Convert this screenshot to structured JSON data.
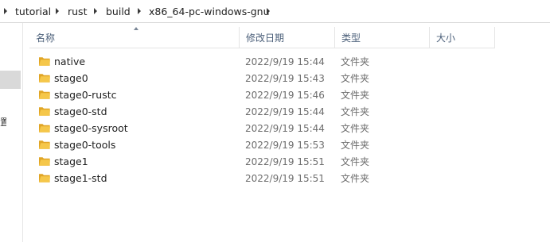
{
  "breadcrumb": {
    "items": [
      "tutorial",
      "rust",
      "build",
      "x86_64-pc-windows-gnu"
    ]
  },
  "nav": {
    "peek_char": "置"
  },
  "columns": {
    "name": "名称",
    "date": "修改日期",
    "type": "类型",
    "size": "大小"
  },
  "files": [
    {
      "name": "native",
      "date": "2022/9/19 15:44",
      "type": "文件夹"
    },
    {
      "name": "stage0",
      "date": "2022/9/19 15:43",
      "type": "文件夹"
    },
    {
      "name": "stage0-rustc",
      "date": "2022/9/19 15:46",
      "type": "文件夹"
    },
    {
      "name": "stage0-std",
      "date": "2022/9/19 15:44",
      "type": "文件夹"
    },
    {
      "name": "stage0-sysroot",
      "date": "2022/9/19 15:44",
      "type": "文件夹"
    },
    {
      "name": "stage0-tools",
      "date": "2022/9/19 15:53",
      "type": "文件夹"
    },
    {
      "name": "stage1",
      "date": "2022/9/19 15:51",
      "type": "文件夹"
    },
    {
      "name": "stage1-std",
      "date": "2022/9/19 15:51",
      "type": "文件夹"
    }
  ],
  "icons": {
    "folder": "folder-icon",
    "breadcrumb_separator": "chevron-right-icon",
    "sort": "sort-ascending-icon"
  },
  "colors": {
    "folder_body": "#F5C74A",
    "folder_back": "#E0A526",
    "header_text": "#4C607A",
    "secondary_text": "#6D6D6D",
    "nav_selected": "#D9D9D9"
  }
}
